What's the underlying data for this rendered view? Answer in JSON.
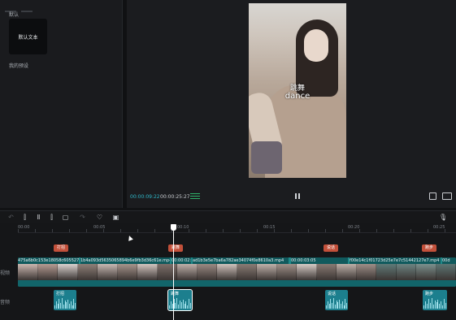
{
  "left_panel": {
    "section_label": "默认",
    "preset_card_label": "默认文本",
    "preset_name": "我的预设"
  },
  "preview": {
    "caption_cn": "跳舞",
    "caption_en": "dance",
    "time_current": "00:00:09:22",
    "time_total": "00:00:25:27",
    "icons": [
      "waveform-bars-icon",
      "pause-icon",
      "screenshot-icon",
      "fullscreen-icon"
    ]
  },
  "toolbar": {
    "tools": [
      "undo-icon",
      "split-left-icon",
      "split-icon",
      "split-right-icon",
      "delete-icon",
      "redo-icon",
      "marker-icon",
      "crop-icon",
      "microphone-icon"
    ]
  },
  "timeline": {
    "ticks": [
      "00:00",
      "00:05",
      "00:10",
      "00:15",
      "00:20",
      "00:25"
    ],
    "markers": [
      "打招",
      "跳舞",
      "说话",
      "跑步"
    ],
    "video_clips": [
      "475a6b0c153e18058c6055272",
      "1b4a093d5635065894b6e9fb3d36c61e.mp4",
      "00:00:02:2",
      "ad1b3e5e7ba6a782ae34074f0e8610a3.mp4",
      "00:00:03:05",
      "f00e14c1f01723d25e7e7c51442127e7.mp4",
      "00d"
    ],
    "audio_labels": [
      "打招",
      "跳舞",
      "说话",
      "跑步"
    ],
    "lanes": [
      "视频",
      "音频"
    ]
  },
  "colors": {
    "accent": "#2fb7c8",
    "clip": "#1f8a8a",
    "marker": "#c2503a"
  }
}
